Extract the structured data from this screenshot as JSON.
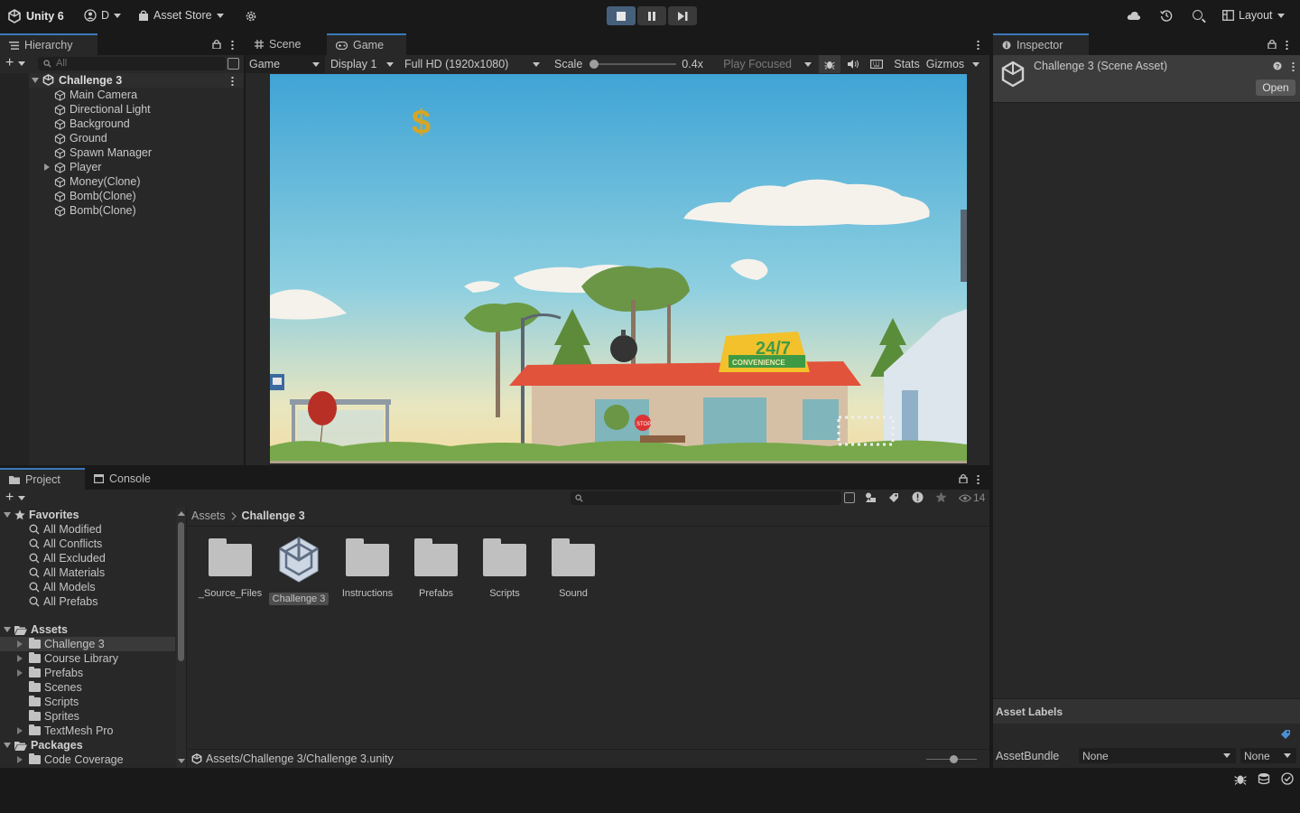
{
  "toolbar": {
    "app": "Unity 6",
    "account": "D",
    "asset_store": "Asset Store",
    "layout": "Layout"
  },
  "hierarchy": {
    "tab": "Hierarchy",
    "search_placeholder": "All",
    "scene": "Challenge 3",
    "items": [
      {
        "label": "Main Camera"
      },
      {
        "label": "Directional Light"
      },
      {
        "label": "Background"
      },
      {
        "label": "Ground"
      },
      {
        "label": "Spawn Manager"
      },
      {
        "label": "Player"
      },
      {
        "label": "Money(Clone)"
      },
      {
        "label": "Bomb(Clone)"
      },
      {
        "label": "Bomb(Clone)"
      }
    ]
  },
  "game_view": {
    "tabs": {
      "scene": "Scene",
      "game": "Game"
    },
    "mode": "Game",
    "display": "Display 1",
    "resolution": "Full HD (1920x1080)",
    "scale_label": "Scale",
    "scale_value": "0.4x",
    "play_mode": "Play Focused",
    "stats": "Stats",
    "gizmos": "Gizmos",
    "scale_fraction": 0.0,
    "sign_top": "24/7",
    "sign_bottom": "CONVENIENCE",
    "stop_sign": "STOP"
  },
  "inspector": {
    "tab": "Inspector",
    "title": "Challenge 3 (Scene Asset)",
    "open_button": "Open",
    "asset_labels": "Asset Labels",
    "asset_bundle_label": "AssetBundle",
    "asset_bundle_value": "None",
    "asset_bundle_variant": "None"
  },
  "project": {
    "tabs": {
      "project": "Project",
      "console": "Console"
    },
    "hidden_count": "14",
    "favorites_label": "Favorites",
    "favorites": [
      "All Modified",
      "All Conflicts",
      "All Excluded",
      "All Materials",
      "All Models",
      "All Prefabs"
    ],
    "assets_label": "Assets",
    "asset_folders": [
      "Challenge 3",
      "Course Library",
      "Prefabs",
      "Scenes",
      "Scripts",
      "Sprites",
      "TextMesh Pro"
    ],
    "packages_label": "Packages",
    "package_folders": [
      "Code Coverage"
    ],
    "breadcrumb": {
      "root": "Assets",
      "current": "Challenge 3"
    },
    "grid_items": [
      "_Source_Files",
      "Challenge 3",
      "Instructions",
      "Prefabs",
      "Scripts",
      "Sound"
    ],
    "footer_path": "Assets/Challenge 3/Challenge 3.unity"
  }
}
